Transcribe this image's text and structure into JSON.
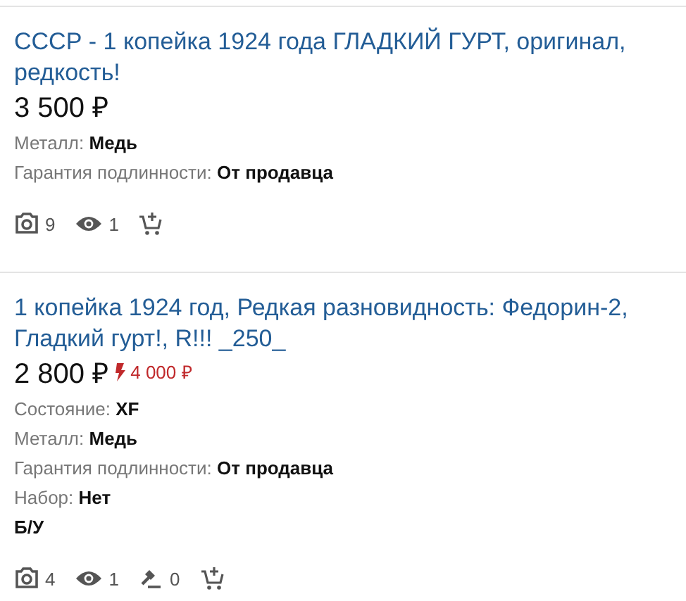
{
  "listings": [
    {
      "title": "СССР - 1 копейка 1924 года ГЛАДКИЙ ГУРТ, оригинал, редкость!",
      "price": "3 500 ₽",
      "attributes": [
        {
          "label": "Металл:",
          "value": "Медь"
        },
        {
          "label": "Гарантия подлинности:",
          "value": "От продавца"
        }
      ],
      "stats": [
        {
          "kind": "photos",
          "count": "9"
        },
        {
          "kind": "views",
          "count": "1"
        },
        {
          "kind": "cart"
        }
      ]
    },
    {
      "title": "1 копейка 1924 год, Редкая разновидность: Федорин-2, Гладкий гурт!, R!!! _250_",
      "price": "2 800 ₽",
      "old_price": "4 000 ₽",
      "attributes": [
        {
          "label": "Состояние:",
          "value": "XF"
        },
        {
          "label": "Металл:",
          "value": "Медь"
        },
        {
          "label": "Гарантия подлинности:",
          "value": "От продавца"
        },
        {
          "label": "Набор:",
          "value": "Нет"
        }
      ],
      "note": "Б/У",
      "stats": [
        {
          "kind": "photos",
          "count": "4"
        },
        {
          "kind": "views",
          "count": "1"
        },
        {
          "kind": "bids",
          "count": "0"
        },
        {
          "kind": "cart"
        }
      ]
    }
  ]
}
